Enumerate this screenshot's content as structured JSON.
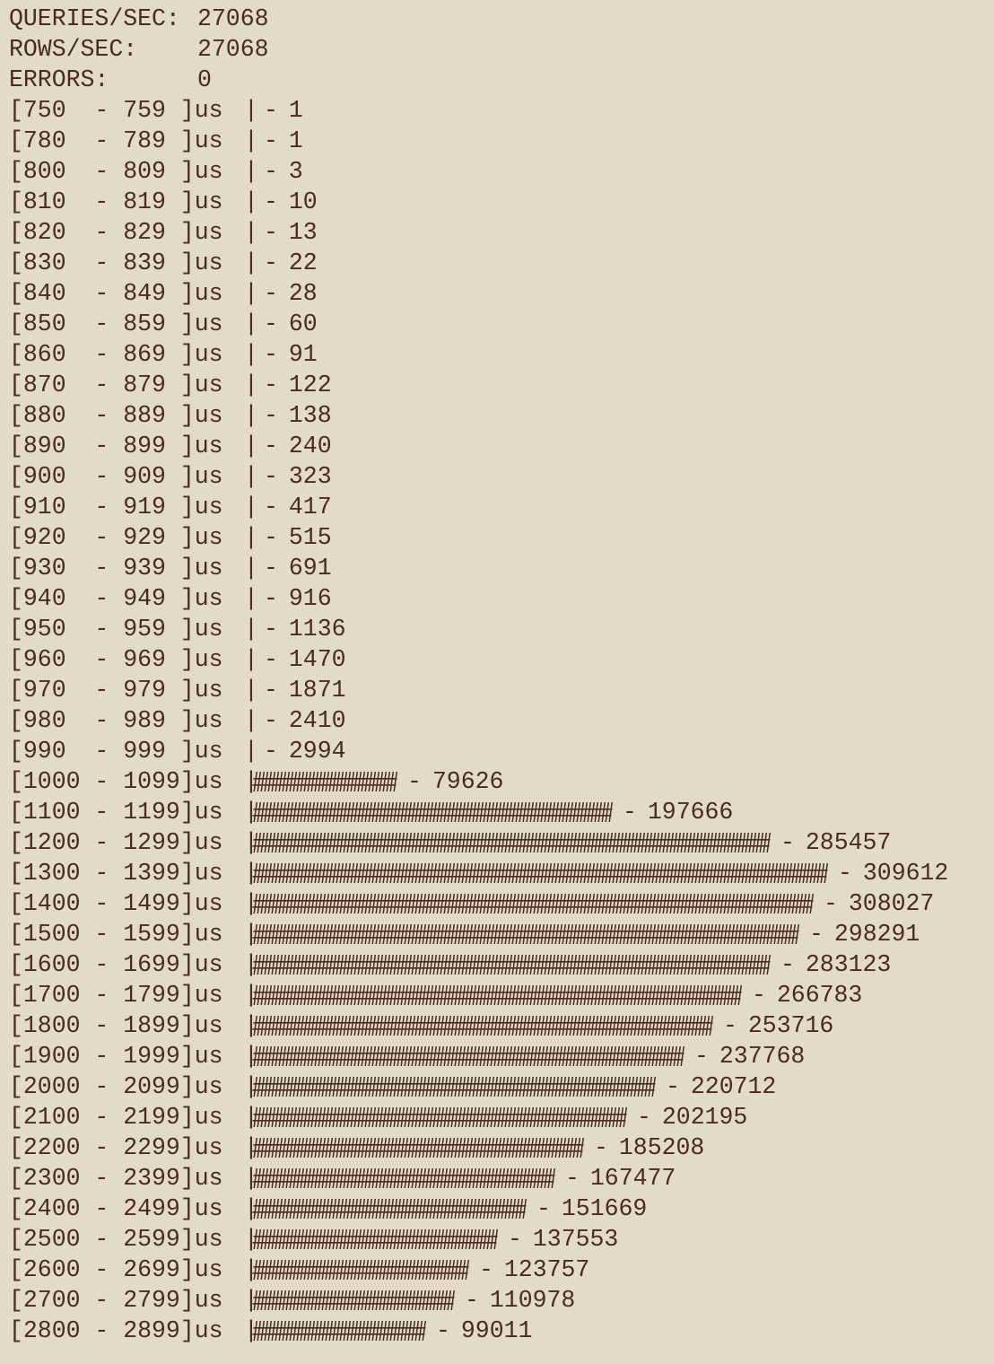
{
  "stats": [
    {
      "label": "QUERIES/SEC:",
      "value": "27068"
    },
    {
      "label": "ROWS/SEC:",
      "value": "27068"
    },
    {
      "label": "ERRORS:",
      "value": "0"
    }
  ],
  "histogram": {
    "separator": "|",
    "dash": "-",
    "bar_char": "#",
    "rows": [
      {
        "range": "[750  - 759 ]us",
        "count": "1",
        "hashes": 0
      },
      {
        "range": "[780  - 789 ]us",
        "count": "1",
        "hashes": 0
      },
      {
        "range": "[800  - 809 ]us",
        "count": "3",
        "hashes": 0
      },
      {
        "range": "[810  - 819 ]us",
        "count": "10",
        "hashes": 0
      },
      {
        "range": "[820  - 829 ]us",
        "count": "13",
        "hashes": 0
      },
      {
        "range": "[830  - 839 ]us",
        "count": "22",
        "hashes": 0
      },
      {
        "range": "[840  - 849 ]us",
        "count": "28",
        "hashes": 0
      },
      {
        "range": "[850  - 859 ]us",
        "count": "60",
        "hashes": 0
      },
      {
        "range": "[860  - 869 ]us",
        "count": "91",
        "hashes": 0
      },
      {
        "range": "[870  - 879 ]us",
        "count": "122",
        "hashes": 0
      },
      {
        "range": "[880  - 889 ]us",
        "count": "138",
        "hashes": 0
      },
      {
        "range": "[890  - 899 ]us",
        "count": "240",
        "hashes": 0
      },
      {
        "range": "[900  - 909 ]us",
        "count": "323",
        "hashes": 0
      },
      {
        "range": "[910  - 919 ]us",
        "count": "417",
        "hashes": 0
      },
      {
        "range": "[920  - 929 ]us",
        "count": "515",
        "hashes": 0
      },
      {
        "range": "[930  - 939 ]us",
        "count": "691",
        "hashes": 0
      },
      {
        "range": "[940  - 949 ]us",
        "count": "916",
        "hashes": 0
      },
      {
        "range": "[950  - 959 ]us",
        "count": "1136",
        "hashes": 0
      },
      {
        "range": "[960  - 969 ]us",
        "count": "1470",
        "hashes": 0
      },
      {
        "range": "[970  - 979 ]us",
        "count": "1871",
        "hashes": 0
      },
      {
        "range": "[980  - 989 ]us",
        "count": "2410",
        "hashes": 0
      },
      {
        "range": "[990  - 999 ]us",
        "count": "2994",
        "hashes": 0
      },
      {
        "range": "[1000 - 1099]us",
        "count": "79626",
        "hashes": 10
      },
      {
        "range": "[1100 - 1199]us",
        "count": "197666",
        "hashes": 25
      },
      {
        "range": "[1200 - 1299]us",
        "count": "285457",
        "hashes": 36
      },
      {
        "range": "[1300 - 1399]us",
        "count": "309612",
        "hashes": 40
      },
      {
        "range": "[1400 - 1499]us",
        "count": "308027",
        "hashes": 39
      },
      {
        "range": "[1500 - 1599]us",
        "count": "298291",
        "hashes": 38
      },
      {
        "range": "[1600 - 1699]us",
        "count": "283123",
        "hashes": 36
      },
      {
        "range": "[1700 - 1799]us",
        "count": "266783",
        "hashes": 34
      },
      {
        "range": "[1800 - 1899]us",
        "count": "253716",
        "hashes": 32
      },
      {
        "range": "[1900 - 1999]us",
        "count": "237768",
        "hashes": 30
      },
      {
        "range": "[2000 - 2099]us",
        "count": "220712",
        "hashes": 28
      },
      {
        "range": "[2100 - 2199]us",
        "count": "202195",
        "hashes": 26
      },
      {
        "range": "[2200 - 2299]us",
        "count": "185208",
        "hashes": 23
      },
      {
        "range": "[2300 - 2399]us",
        "count": "167477",
        "hashes": 21
      },
      {
        "range": "[2400 - 2499]us",
        "count": "151669",
        "hashes": 19
      },
      {
        "range": "[2500 - 2599]us",
        "count": "137553",
        "hashes": 17
      },
      {
        "range": "[2600 - 2699]us",
        "count": "123757",
        "hashes": 15
      },
      {
        "range": "[2700 - 2799]us",
        "count": "110978",
        "hashes": 14
      },
      {
        "range": "[2800 - 2899]us",
        "count": "99011",
        "hashes": 12
      }
    ]
  }
}
